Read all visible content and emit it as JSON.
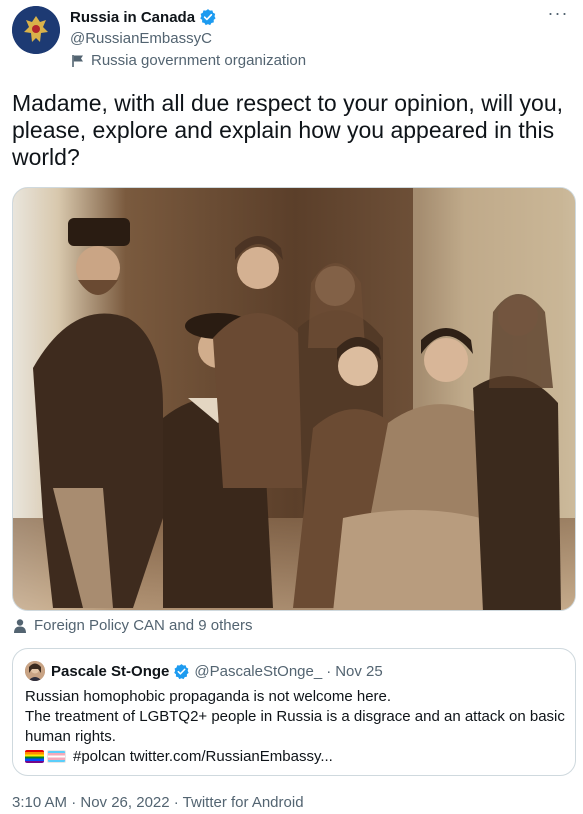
{
  "author": {
    "name": "Russia in Canada",
    "handle": "@RussianEmbassyC",
    "label": "Russia government organization"
  },
  "more_label": "···",
  "tweet": {
    "text": "Madame, with all due respect to your opinion, will you, please, explore and explain how you appeared in this world?"
  },
  "tagged": {
    "text": "Foreign Policy CAN and 9 others"
  },
  "quote": {
    "name": "Pascale St-Onge",
    "handle": "@PascaleStOnge_",
    "separator": "·",
    "date": "Nov 25",
    "line1": "Russian homophobic propaganda is not welcome here.",
    "line2": "The treatment of LGBTQ2+ people in Russia is a disgrace and an attack on basic human rights.",
    "line3": "#polcan twitter.com/RussianEmbassy..."
  },
  "meta": {
    "text": "3:10 AM · Nov 26, 2022 · Twitter for Android"
  },
  "colors": {
    "verified": "#1d9bf0",
    "secondary_text": "#536471",
    "border": "#cfd9de"
  },
  "icons": {
    "verified": "verified-badge-icon",
    "org": "flag-icon",
    "tagged": "person-icon",
    "more": "more-icon"
  }
}
